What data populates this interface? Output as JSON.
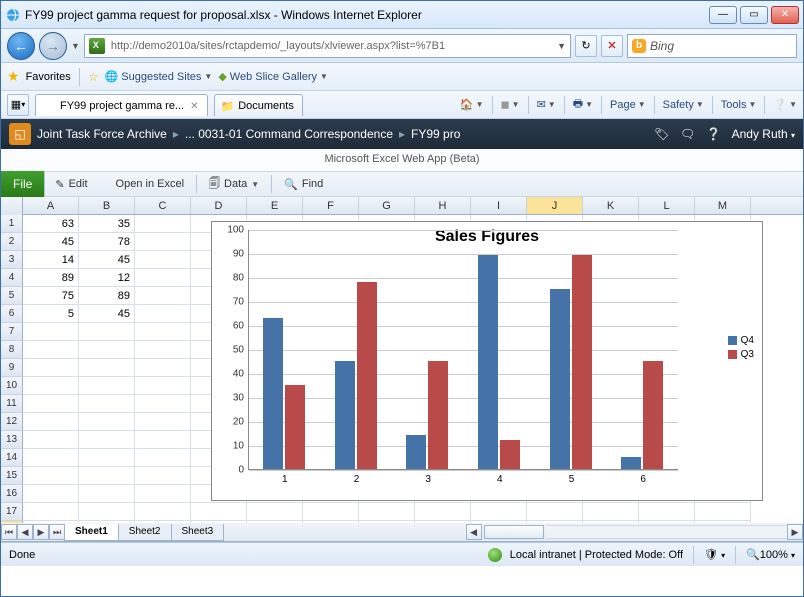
{
  "window": {
    "title": "FY99 project gamma request for proposal.xlsx - Windows Internet Explorer"
  },
  "address_bar": {
    "url": "http://demo2010a/sites/rctapdemo/_layouts/xlviewer.aspx?list=%7B1"
  },
  "search": {
    "provider": "Bing"
  },
  "favorites": {
    "label": "Favorites",
    "suggested": "Suggested Sites",
    "webslice": "Web Slice Gallery"
  },
  "tabs": {
    "primary": "FY99 project gamma re...",
    "secondary": "Documents",
    "menus": {
      "page": "Page",
      "safety": "Safety",
      "tools": "Tools"
    }
  },
  "sharepoint": {
    "crumb1": "Joint Task Force Archive",
    "crumb2": "... 0031-01 Command Correspondence",
    "crumb3": "FY99 pro",
    "user": "Andy Ruth"
  },
  "app_name": "Microsoft Excel Web App (Beta)",
  "ribbon": {
    "file": "File",
    "edit": "Edit",
    "open": "Open in Excel",
    "data": "Data",
    "find": "Find"
  },
  "columns": [
    "A",
    "B",
    "C",
    "D",
    "E",
    "F",
    "G",
    "H",
    "I",
    "J",
    "K",
    "L",
    "M"
  ],
  "selected_col": "J",
  "row_count": 18,
  "data_rows": [
    {
      "A": "63",
      "B": "35"
    },
    {
      "A": "45",
      "B": "78"
    },
    {
      "A": "14",
      "B": "45"
    },
    {
      "A": "89",
      "B": "12"
    },
    {
      "A": "75",
      "B": "89"
    },
    {
      "A": "5",
      "B": "45"
    }
  ],
  "sheets": {
    "s1": "Sheet1",
    "s2": "Sheet2",
    "s3": "Sheet3"
  },
  "chart_data": {
    "type": "bar",
    "title": "Sales Figures",
    "ylim": [
      0,
      100
    ],
    "yticks": [
      0,
      10,
      20,
      30,
      40,
      50,
      60,
      70,
      80,
      90,
      100
    ],
    "categories": [
      "1",
      "2",
      "3",
      "4",
      "5",
      "6"
    ],
    "series": [
      {
        "name": "Q4",
        "color": "#4573a7",
        "values": [
          63,
          45,
          14,
          89,
          75,
          5
        ]
      },
      {
        "name": "Q3",
        "color": "#b84b49",
        "values": [
          35,
          78,
          45,
          12,
          89,
          45
        ]
      }
    ]
  },
  "status": {
    "left": "Done",
    "zone": "Local intranet | Protected Mode: Off",
    "zoom": "100%"
  }
}
